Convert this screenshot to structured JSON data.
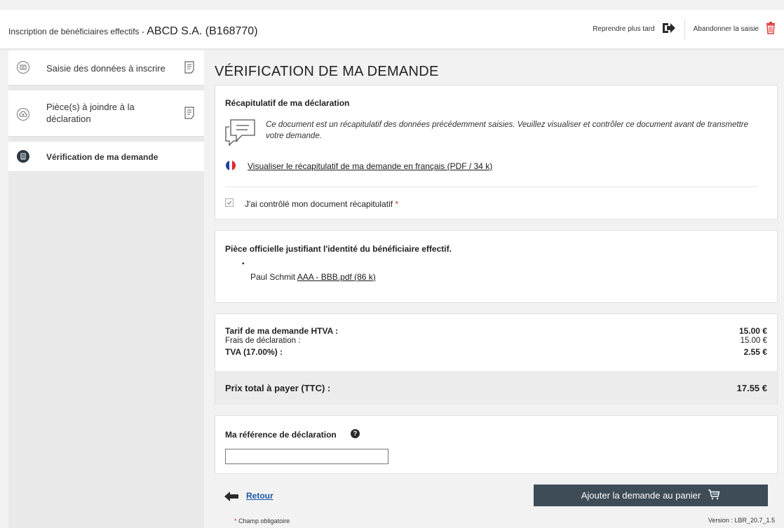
{
  "header": {
    "subtitle": "Inscription de bénéficiaires effectifs - ",
    "company": "ABCD S.A. (B168770)",
    "resume_label": "Reprendre plus tard",
    "abandon_label": "Abandonner la saisie"
  },
  "sidebar": {
    "items": [
      {
        "label": "Saisie des données à inscrire"
      },
      {
        "label": "Pièce(s) à joindre à la déclaration"
      },
      {
        "label": "Vérification de ma demande"
      }
    ]
  },
  "main": {
    "title": "VÉRIFICATION DE MA DEMANDE",
    "recap": {
      "heading": "Récapitulatif de ma déclaration",
      "text": "Ce document est un récapitulatif des données précédemment saisies. Veuillez visualiser et contrôler ce document avant de transmettre votre demande.",
      "link": "Visualiser le récapitulatif de ma demande en français (PDF / 34 k)",
      "check_label": "J'ai contrôlé mon document récapitulatif",
      "required_mark": "*"
    },
    "piece": {
      "heading": "Pièce officielle justifiant l'identité du bénéficiaire effectif.",
      "bullet": "•",
      "person": "Paul Schmit",
      "file": "AAA - BBB.pdf (86 k)"
    },
    "tarif": {
      "lines": [
        {
          "label": "Tarif de ma demande HTVA :",
          "value": "15.00 €",
          "bold": true
        },
        {
          "label": "Frais de déclaration :",
          "value": "15.00 €",
          "bold": false
        },
        {
          "label": "TVA (17.00%) :",
          "value": "2.55 €",
          "bold": true
        }
      ],
      "total_label": "Prix total à payer (TTC) :",
      "total_value": "17.55 €"
    },
    "reference": {
      "label": "Ma référence de déclaration",
      "value": ""
    },
    "footer": {
      "back_label": "Retour",
      "add_label": "Ajouter la demande au panier",
      "required_note_mark": "*",
      "required_note": "Champ obligatoire",
      "version": "Version : LBR_20.7_1.5"
    }
  },
  "colors": {
    "accent": "#3d4c57",
    "danger": "#e03b3b",
    "required": "#d9342b"
  }
}
